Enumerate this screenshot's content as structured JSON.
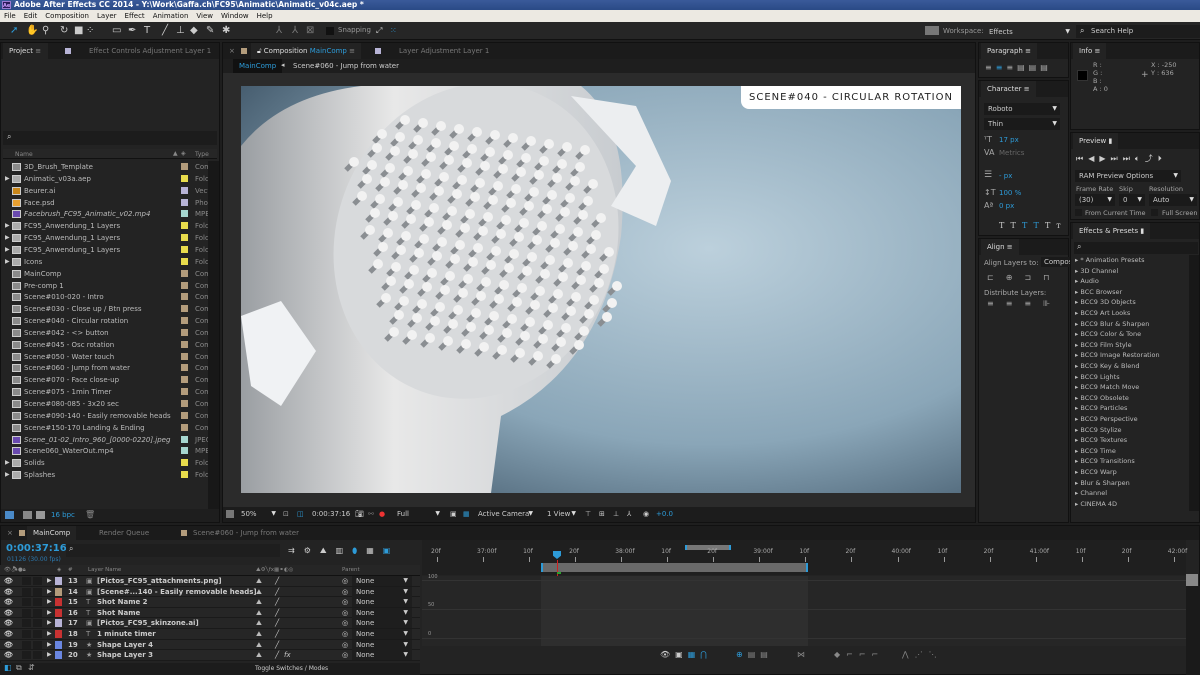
{
  "app": {
    "title": "Adobe After Effects CC 2014 - Y:\\Work\\Gaffa.ch\\FC95\\Animatic\\Animatic_v04c.aep *",
    "logo": "Ae"
  },
  "menu": [
    "File",
    "Edit",
    "Composition",
    "Layer",
    "Effect",
    "Animation",
    "View",
    "Window",
    "Help"
  ],
  "toolbar": {
    "snapping": "Snapping",
    "workspace_label": "Workspace:",
    "workspace": "Effects",
    "search_help": "Search Help"
  },
  "project": {
    "tab": "Project",
    "effect_controls_tab": "Effect Controls  Adjustment Layer 1",
    "columns": {
      "name": "Name",
      "type": "Type"
    },
    "items": [
      {
        "name": "3D_Brush_Template",
        "kind": "comp",
        "type": "Com",
        "color": "#b39c7c"
      },
      {
        "name": "Animatic_v03a.aep",
        "kind": "folder",
        "type": "Fold",
        "color": "#e8dc4c",
        "expand": true
      },
      {
        "name": "Beurer.ai",
        "kind": "ai",
        "type": "Vect",
        "color": "#b7b3d6"
      },
      {
        "name": "Face.psd",
        "kind": "psd",
        "type": "Phot",
        "color": "#b7b3d6"
      },
      {
        "name": "Facebrush_FC95_Animatic_v02.mp4",
        "kind": "video",
        "type": "MPE",
        "color": "#a6d6cf",
        "italic": true
      },
      {
        "name": "FC95_Anwendung_1 Layers",
        "kind": "folder",
        "type": "Fold",
        "color": "#e8dc4c",
        "expand": true
      },
      {
        "name": "FC95_Anwendung_1 Layers",
        "kind": "folder",
        "type": "Fold",
        "color": "#e8dc4c",
        "expand": true
      },
      {
        "name": "FC95_Anwendung_1 Layers",
        "kind": "folder",
        "type": "Fold",
        "color": "#e8dc4c",
        "expand": true
      },
      {
        "name": "Icons",
        "kind": "folder",
        "type": "Fold",
        "color": "#e8dc4c",
        "expand": true
      },
      {
        "name": "MainComp",
        "kind": "comp",
        "type": "Com",
        "color": "#b39c7c"
      },
      {
        "name": "Pre-comp 1",
        "kind": "comp",
        "type": "Com",
        "color": "#b39c7c"
      },
      {
        "name": "Scene#010-020 - Intro",
        "kind": "comp",
        "type": "Com",
        "color": "#b39c7c"
      },
      {
        "name": "Scene#030 - Close up / Btn press",
        "kind": "comp",
        "type": "Com",
        "color": "#b39c7c"
      },
      {
        "name": "Scene#040 - Circular rotation",
        "kind": "comp",
        "type": "Com",
        "color": "#b39c7c"
      },
      {
        "name": "Scene#042 - <> button",
        "kind": "comp",
        "type": "Com",
        "color": "#b39c7c"
      },
      {
        "name": "Scene#045 - Osc rotation",
        "kind": "comp",
        "type": "Com",
        "color": "#b39c7c"
      },
      {
        "name": "Scene#050 - Water touch",
        "kind": "comp",
        "type": "Com",
        "color": "#b39c7c"
      },
      {
        "name": "Scene#060 - Jump from water",
        "kind": "comp",
        "type": "Com",
        "color": "#b39c7c"
      },
      {
        "name": "Scene#070 - Face close-up",
        "kind": "comp",
        "type": "Com",
        "color": "#b39c7c"
      },
      {
        "name": "Scene#075 - 1min Timer",
        "kind": "comp",
        "type": "Com",
        "color": "#b39c7c"
      },
      {
        "name": "Scene#080-085 - 3x20 sec",
        "kind": "comp",
        "type": "Com",
        "color": "#b39c7c"
      },
      {
        "name": "Scene#090-140 - Easily removable heads",
        "kind": "comp",
        "type": "Com",
        "color": "#b39c7c"
      },
      {
        "name": "Scene#150-170 Landing & Ending",
        "kind": "comp",
        "type": "Com",
        "color": "#b39c7c"
      },
      {
        "name": "Scene_01-02_Intro_960_[0000-0220].jpeg",
        "kind": "video",
        "type": "JPEG",
        "color": "#a6d6cf",
        "italic": true
      },
      {
        "name": "Scene060_WaterOut.mp4",
        "kind": "video",
        "type": "MPE",
        "color": "#a6d6cf"
      },
      {
        "name": "Solids",
        "kind": "folder",
        "type": "Fold",
        "color": "#e8dc4c",
        "expand": true
      },
      {
        "name": "Splashes",
        "kind": "folder",
        "type": "Fold",
        "color": "#e8dc4c",
        "expand": true
      }
    ],
    "bpc": "16 bpc"
  },
  "composition": {
    "tab_prefix": "Composition",
    "tab_comp": "MainComp",
    "layer_tab": "Layer  Adjustment Layer 1",
    "breadcrumb": [
      "MainComp",
      "Scene#060 - Jump from water"
    ],
    "overlay_title": "SCENE#040 - CIRCULAR ROTATION",
    "footer": {
      "zoom": "50%",
      "timecode": "0:00:37:16",
      "resolution": "Full",
      "camera": "Active Camera",
      "views": "1 View",
      "exposure": "+0.0"
    }
  },
  "paragraph": {
    "tab": "Paragraph"
  },
  "info": {
    "tab": "Info",
    "r": "R :",
    "g": "G :",
    "b": "B :",
    "a": "A : 0",
    "x": "X : -250",
    "y": "Y : 636"
  },
  "character": {
    "tab": "Character",
    "font": "Roboto",
    "style": "Thin",
    "size": "17 px",
    "kerning": "Metrics",
    "leading": "- px",
    "vscale": "100 %",
    "baseline": "0 px"
  },
  "preview": {
    "tab": "Preview",
    "options": "RAM Preview Options",
    "frame_rate_label": "Frame Rate",
    "skip_label": "Skip",
    "resolution_label": "Resolution",
    "frame_rate": "(30)",
    "skip": "0",
    "resolution": "Auto",
    "from_current": "From Current Time",
    "full_screen": "Full Screen"
  },
  "align": {
    "tab": "Align",
    "align_to_label": "Align Layers to:",
    "align_to": "Compos",
    "distribute": "Distribute Layers:"
  },
  "effects": {
    "tab": "Effects & Presets",
    "items": [
      "* Animation Presets",
      "3D Channel",
      "Audio",
      "BCC Browser",
      "BCC9 3D Objects",
      "BCC9 Art Looks",
      "BCC9 Blur & Sharpen",
      "BCC9 Color & Tone",
      "BCC9 Film Style",
      "BCC9 Image Restoration",
      "BCC9 Key & Blend",
      "BCC9 Lights",
      "BCC9 Match Move",
      "BCC9 Obsolete",
      "BCC9 Particles",
      "BCC9 Perspective",
      "BCC9 Stylize",
      "BCC9 Textures",
      "BCC9 Time",
      "BCC9 Transitions",
      "BCC9 Warp",
      "Blur & Sharpen",
      "Channel",
      "CINEMA 4D"
    ]
  },
  "timeline": {
    "tabs": [
      "MainComp",
      "Render Queue",
      "Scene#060 - Jump from water"
    ],
    "timecode": "0:00:37:16",
    "frame_info": "01126 (30.00 fps)",
    "columns": {
      "num": "#",
      "layer_name": "Layer Name",
      "parent": "Parent"
    },
    "layers": [
      {
        "num": "13",
        "name": "[Pictos_FC95_attachments.png]",
        "color": "#b7b3d6",
        "kind": "png",
        "parent": "None"
      },
      {
        "num": "14",
        "name": "[Scene#...140 - Easily removable heads]",
        "color": "#b39c7c",
        "kind": "comp",
        "parent": "None"
      },
      {
        "num": "15",
        "name": "Shot Name 2",
        "color": "#c83232",
        "kind": "text",
        "parent": "None"
      },
      {
        "num": "16",
        "name": "Shot Name",
        "color": "#c83232",
        "kind": "text",
        "parent": "None"
      },
      {
        "num": "17",
        "name": "[Pictos_FC95_skinzone.ai]",
        "color": "#b7b3d6",
        "kind": "ai",
        "parent": "None"
      },
      {
        "num": "18",
        "name": "1 minute timer",
        "color": "#c83232",
        "kind": "text",
        "parent": "None"
      },
      {
        "num": "19",
        "name": "Shape Layer 4",
        "color": "#6a86e0",
        "kind": "shape",
        "parent": "None"
      },
      {
        "num": "20",
        "name": "Shape Layer 3",
        "color": "#6a86e0",
        "kind": "shape",
        "parent": "None",
        "fx": true
      }
    ],
    "ruler": [
      "20f",
      "37:00f",
      "10f",
      "20f",
      "38:00f",
      "10f",
      "20f",
      "39:00f",
      "10f",
      "20f",
      "40:00f",
      "10f",
      "20f",
      "41:00f",
      "10f",
      "20f",
      "42:00f"
    ],
    "graph_values": [
      "100",
      "50",
      "0"
    ],
    "toggle": "Toggle Switches / Modes"
  },
  "colors": {
    "accent": "#2d9bd8",
    "panel": "#232323"
  }
}
